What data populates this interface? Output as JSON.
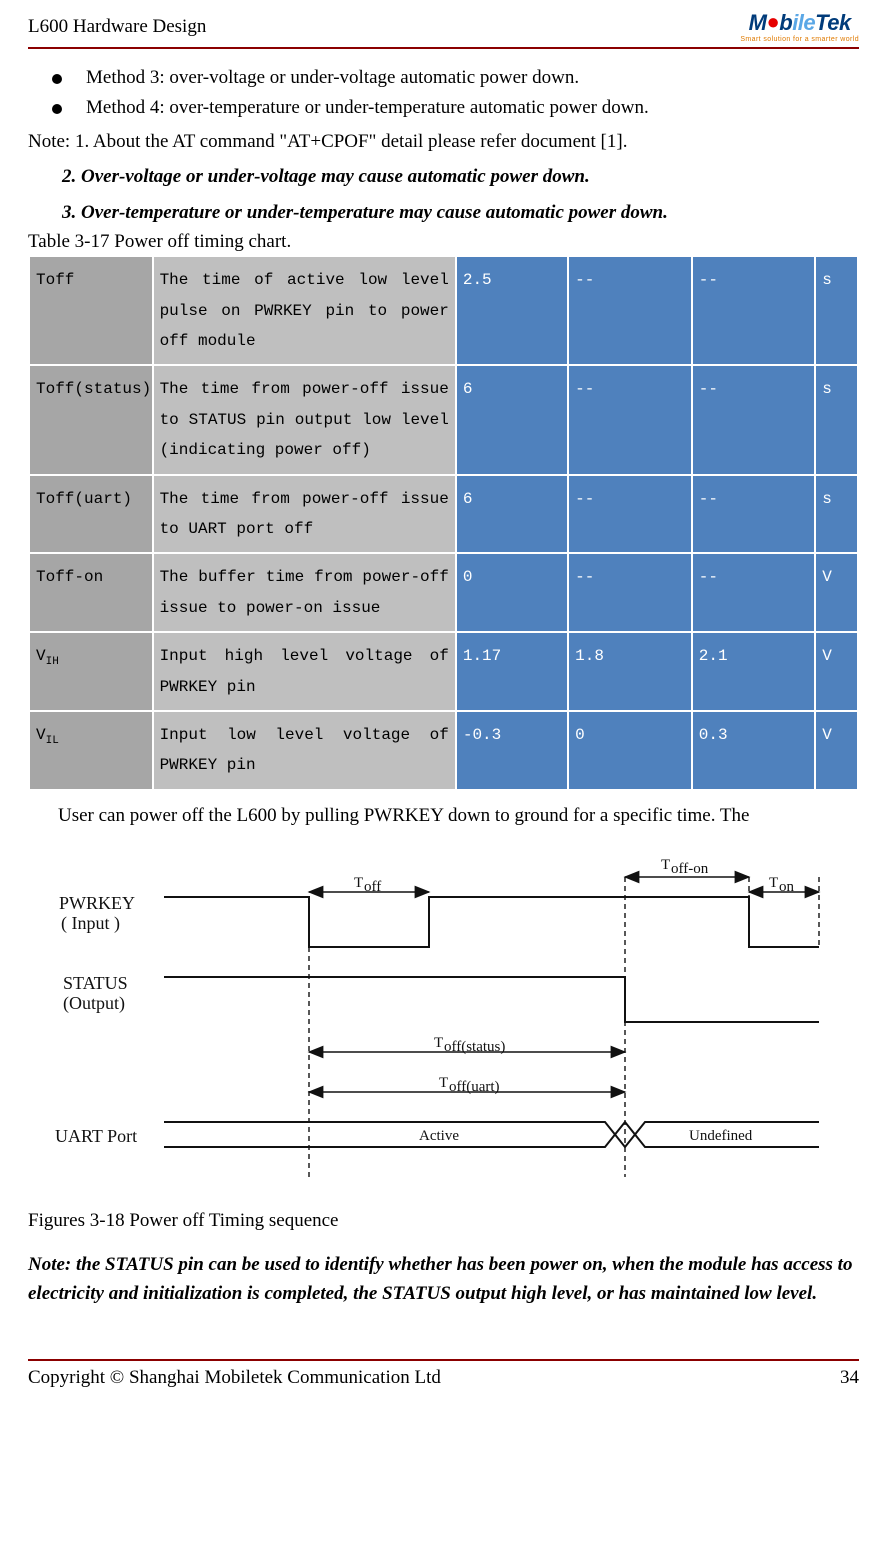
{
  "header": {
    "title": "L600 Hardware Design",
    "logo_main_mo": "M",
    "logo_main_o": "o",
    "logo_main_b": "b",
    "logo_main_il": "ile",
    "logo_main_tek": "Tek",
    "logo_tag": "Smart solution for a smarter world"
  },
  "bullets": [
    "Method 3: over-voltage or under-voltage automatic power down.",
    "Method 4: over-temperature or under-temperature automatic power down."
  ],
  "note_line1": "Note: 1. About the AT command \"AT+CPOF\" detail please refer document [1].",
  "note_line2": "2. Over-voltage or under-voltage may cause automatic power down.",
  "note_line3": "3. Over-temperature or under-temperature may cause automatic power down.",
  "table_caption": "Table 3-17 Power off timing chart.",
  "rows": [
    {
      "p": "Toff",
      "desc": "The time of active low level pulse on PWRKEY pin to power off module",
      "min": "2.5",
      "typ": "--",
      "max": "--",
      "u": "s"
    },
    {
      "p": "Toff(status)",
      "desc": "The time from power-off issue to STATUS pin output low level (indicating power off)",
      "min": "6",
      "typ": "--",
      "max": "--",
      "u": "s"
    },
    {
      "p": "Toff(uart)",
      "desc": "The time from power-off issue to UART port off",
      "min": "6",
      "typ": "--",
      "max": "--",
      "u": "s"
    },
    {
      "p": "Toff-on",
      "desc": "The buffer time from power-off issue to power-on issue",
      "min": "0",
      "typ": "--",
      "max": "--",
      "u": "V"
    },
    {
      "p": "VIH",
      "p_sub": "IH",
      "p_pre": "V",
      "desc": "Input high level voltage of PWRKEY pin",
      "min": "1.17",
      "typ": "1.8",
      "max": "2.1",
      "u": "V"
    },
    {
      "p": "VIL",
      "p_sub": "IL",
      "p_pre": "V",
      "desc": "Input low level voltage of PWRKEY pin",
      "min": "-0.3",
      "typ": "0",
      "max": "0.3",
      "u": "V"
    }
  ],
  "after_table": "User can power off the L600 by pulling PWRKEY down to ground for a specific time. The",
  "diagram": {
    "pwrkey_label": "PWRKEY",
    "pwrkey_sub": "( Input )",
    "status_label": "STATUS",
    "status_sub": "(Output)",
    "uart_label": "UART Port",
    "active": "Active",
    "undef": "Undefined",
    "toff": "T",
    "toff_sub": "off",
    "toffon_sub": "off-on",
    "ton_sub": "on",
    "toffstatus_sub": "off(status)",
    "toffuart_sub": "off(uart)"
  },
  "fig_caption": "Figures 3-18 Power off Timing sequence",
  "note_para": "Note: the STATUS pin can be used to identify whether has been power on, when the module has access to electricity and initialization is completed, the STATUS output high level, or has maintained low level.",
  "footer": {
    "copyright": "Copyright © Shanghai Mobiletek Communication Ltd",
    "page": "34"
  }
}
